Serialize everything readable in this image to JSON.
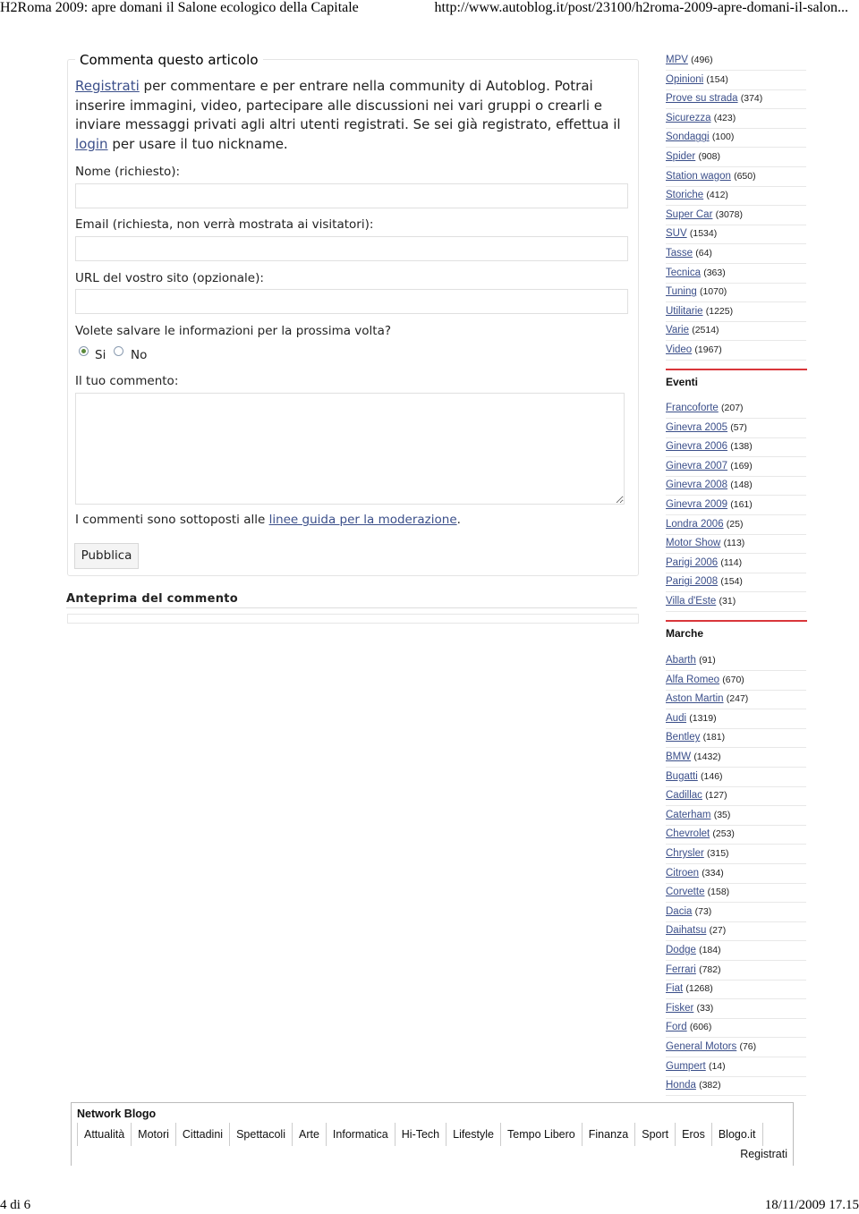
{
  "header": {
    "title": "H2Roma 2009: apre domani il Salone ecologico della Capitale",
    "url": "http://www.autoblog.it/post/23100/h2roma-2009-apre-domani-il-salon..."
  },
  "form": {
    "legend": "Commenta questo articolo",
    "intro_link1": "Registrati",
    "intro_text1": " per commentare e per entrare nella community di Autoblog. Potrai inserire immagini, video, partecipare alle discussioni nei vari gruppi o crearli e inviare messaggi privati agli altri utenti registrati. Se sei già registrato, effettua il ",
    "intro_link2": "login",
    "intro_text2": " per usare il tuo nickname.",
    "name_label": "Nome (richiesto):",
    "email_label": "Email (richiesta, non verrà mostrata ai visitatori):",
    "url_label": "URL del vostro sito (opzionale):",
    "save_label": "Volete salvare le informazioni per la prossima volta?",
    "yes": "Si",
    "no": "No",
    "save_selected": "Si",
    "comment_label": "Il tuo commento:",
    "moderation_text": "I commenti sono sottoposti alle ",
    "moderation_link": "linee guida per la moderazione",
    "moderation_end": ".",
    "publish": "Pubblica",
    "preview_title": "Anteprima del commento"
  },
  "sidebar": {
    "categories": [
      [
        "MPV",
        "(496)"
      ],
      [
        "Opinioni",
        "(154)"
      ],
      [
        "Prove su strada",
        "(374)"
      ],
      [
        "Sicurezza",
        "(423)"
      ],
      [
        "Sondaggi",
        "(100)"
      ],
      [
        "Spider",
        "(908)"
      ],
      [
        "Station wagon",
        "(650)"
      ],
      [
        "Storiche",
        "(412)"
      ],
      [
        "Super Car",
        "(3078)"
      ],
      [
        "SUV",
        "(1534)"
      ],
      [
        "Tasse",
        "(64)"
      ],
      [
        "Tecnica",
        "(363)"
      ],
      [
        "Tuning",
        "(1070)"
      ],
      [
        "Utilitarie",
        "(1225)"
      ],
      [
        "Varie",
        "(2514)"
      ],
      [
        "Video",
        "(1967)"
      ]
    ],
    "eventi_title": "Eventi",
    "eventi": [
      [
        "Francoforte",
        "(207)"
      ],
      [
        "Ginevra 2005",
        "(57)"
      ],
      [
        "Ginevra 2006",
        "(138)"
      ],
      [
        "Ginevra 2007",
        "(169)"
      ],
      [
        "Ginevra 2008",
        "(148)"
      ],
      [
        "Ginevra 2009",
        "(161)"
      ],
      [
        "Londra 2006",
        "(25)"
      ],
      [
        "Motor Show",
        "(113)"
      ],
      [
        "Parigi 2006",
        "(114)"
      ],
      [
        "Parigi 2008",
        "(154)"
      ],
      [
        "Villa d'Este",
        "(31)"
      ]
    ],
    "marche_title": "Marche",
    "marche": [
      [
        "Abarth",
        "(91)"
      ],
      [
        "Alfa Romeo",
        "(670)"
      ],
      [
        "Aston Martin",
        "(247)"
      ],
      [
        "Audi",
        "(1319)"
      ],
      [
        "Bentley",
        "(181)"
      ],
      [
        "BMW",
        "(1432)"
      ],
      [
        "Bugatti",
        "(146)"
      ],
      [
        "Cadillac",
        "(127)"
      ],
      [
        "Caterham",
        "(35)"
      ],
      [
        "Chevrolet",
        "(253)"
      ],
      [
        "Chrysler",
        "(315)"
      ],
      [
        "Citroen",
        "(334)"
      ],
      [
        "Corvette",
        "(158)"
      ],
      [
        "Dacia",
        "(73)"
      ],
      [
        "Daihatsu",
        "(27)"
      ],
      [
        "Dodge",
        "(184)"
      ],
      [
        "Ferrari",
        "(782)"
      ],
      [
        "Fiat",
        "(1268)"
      ],
      [
        "Fisker",
        "(33)"
      ],
      [
        "Ford",
        "(606)"
      ],
      [
        "General Motors",
        "(76)"
      ],
      [
        "Gumpert",
        "(14)"
      ],
      [
        "Honda",
        "(382)"
      ]
    ],
    "accent": "#d9363a"
  },
  "network": {
    "title": "Network Blogo",
    "links": [
      "Attualità",
      "Motori",
      "Cittadini",
      "Spettacoli",
      "Arte",
      "Informatica",
      "Hi-Tech",
      "Lifestyle",
      "Tempo Libero",
      "Finanza",
      "Sport",
      "Eros",
      "Blogo.it"
    ],
    "register": "Registrati"
  },
  "footer": {
    "page": "4 di 6",
    "datetime": "18/11/2009 17.15"
  }
}
